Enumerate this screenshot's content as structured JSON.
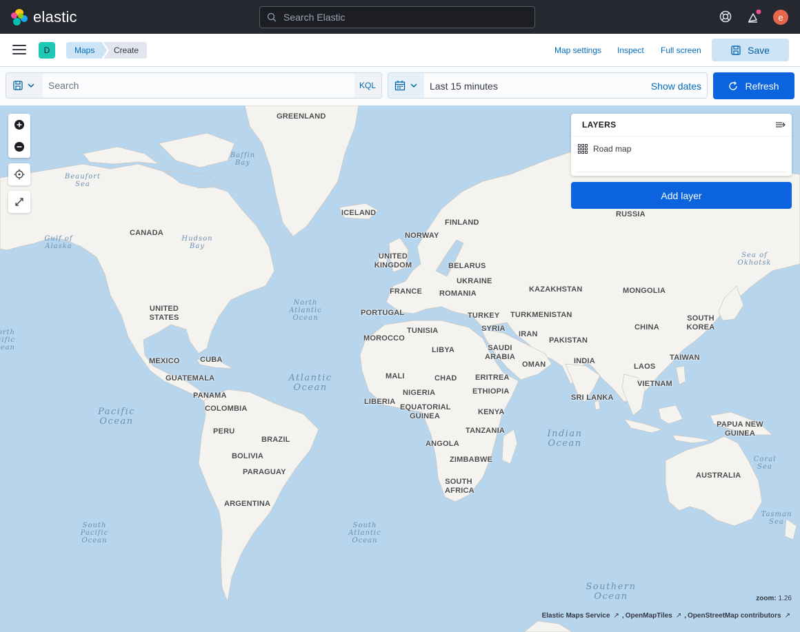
{
  "header": {
    "brand": "elastic",
    "search_placeholder": "Search Elastic",
    "avatar_initial": "e"
  },
  "appbar": {
    "space_initial": "D",
    "breadcrumbs": [
      "Maps",
      "Create"
    ],
    "links": [
      "Map settings",
      "Inspect",
      "Full screen"
    ],
    "save_label": "Save"
  },
  "query": {
    "search_placeholder": "Search",
    "language": "KQL",
    "time_range": "Last 15 minutes",
    "show_dates": "Show dates",
    "refresh_label": "Refresh"
  },
  "map": {
    "layers_title": "LAYERS",
    "layers": [
      "Road map"
    ],
    "add_layer_label": "Add layer",
    "zoom_label": "zoom:",
    "zoom_value": "1.26",
    "attributions": [
      "Elastic Maps Service",
      "OpenMapTiles",
      "OpenStreetMap contributors"
    ],
    "countries": [
      "GREENLAND",
      "ICELAND",
      "CANADA",
      "FINLAND",
      "NORWAY",
      "RUSSIA",
      "UNITED KINGDOM",
      "BELARUS",
      "UKRAINE",
      "FRANCE",
      "ROMANIA",
      "KAZAKHSTAN",
      "MONGOLIA",
      "UNITED STATES",
      "PORTUGAL",
      "TURKEY",
      "TURKMENISTAN",
      "SOUTH KOREA",
      "MOROCCO",
      "TUNISIA",
      "SYRIA",
      "IRAN",
      "CHINA",
      "SAUDI ARABIA",
      "PAKISTAN",
      "LIBYA",
      "MEXICO",
      "CUBA",
      "OMAN",
      "INDIA",
      "TAIWAN",
      "GUATEMALA",
      "MALI",
      "CHAD",
      "ERITREA",
      "LAOS",
      "VIETNAM",
      "PANAMA",
      "NIGERIA",
      "ETHIOPIA",
      "SRI LANKA",
      "COLOMBIA",
      "LIBERIA",
      "EQUATORIAL GUINEA",
      "KENYA",
      "PAPUA NEW GUINEA",
      "PERU",
      "BRAZIL",
      "TANZANIA",
      "ANGOLA",
      "BOLIVIA",
      "ZIMBABWE",
      "PARAGUAY",
      "SOUTH AFRICA",
      "AUSTRALIA",
      "ARGENTINA"
    ],
    "seas": [
      "Baffin Bay",
      "Beaufort Sea",
      "Gulf of Alaska",
      "Hudson Bay",
      "Sea of Okhotsk",
      "North Atlantic Ocean",
      "North Pacific Ocean",
      "Atlantic Ocean",
      "Pacific Ocean",
      "Indian Ocean",
      "Coral Sea",
      "South Pacific Ocean",
      "South Atlantic Ocean",
      "Tasman Sea",
      "Southern Ocean"
    ]
  }
}
